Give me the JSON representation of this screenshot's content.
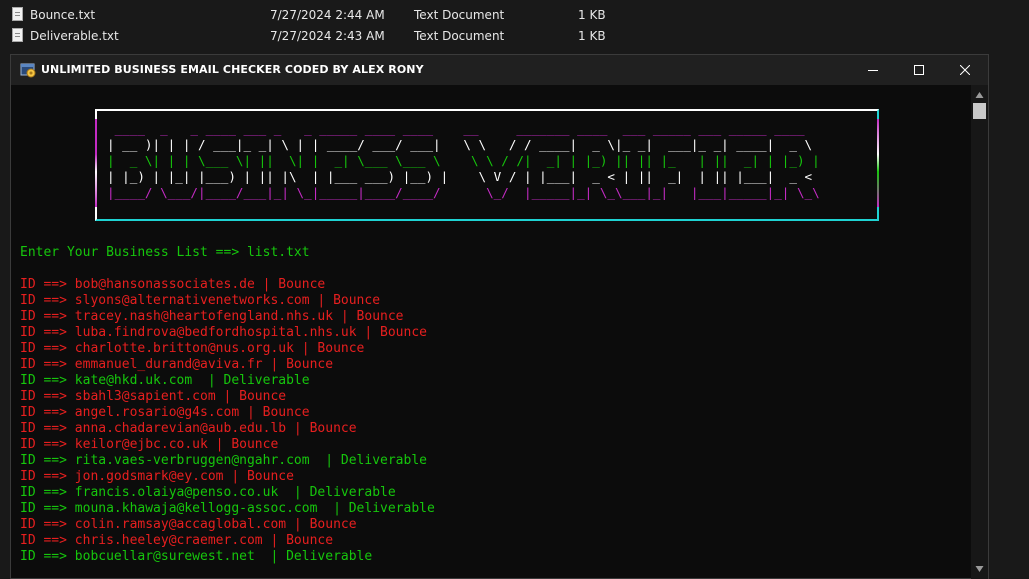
{
  "explorer": {
    "files": [
      {
        "name": "Bounce.txt",
        "modified": "7/27/2024 2:44 AM",
        "type": "Text Document",
        "size": "1 KB"
      },
      {
        "name": "Deliverable.txt",
        "modified": "7/27/2024 2:43 AM",
        "type": "Text Document",
        "size": "1 KB"
      }
    ]
  },
  "window": {
    "title": "UNLIMITED BUSINESS EMAIL CHECKER CODED BY ALEX RONY",
    "icons": {
      "app": "console-app-icon",
      "minimize": "minimize-icon",
      "maximize": "maximize-icon",
      "close": "close-icon"
    }
  },
  "banner": {
    "lines": [
      " ____  _   _ ____ ___ _   _ _____ ____ ____    __     _______ ____  ___ _____ ___ _____ ____  ",
      "| __ )| | | / ___|_ _| \\ | | ____/ ___/ ___|   \\ \\   / / ____|  _ \\|_ _|  ___|_ _| ____|  _ \\ ",
      "|  _ \\| | | \\___ \\| ||  \\| |  _| \\___ \\___ \\    \\ \\ / /|  _| | |_) || || |_   | ||  _| | |_) |",
      "| |_) | |_| |___) | || |\\  | |___ ___) |__) |    \\ V / | |___|  _ < | ||  _|  | || |___|  _ < ",
      "|____/ \\___/|____/___|_| \\_|_____|____/____/      \\_/  |_____|_| \\_\\___|_|   |___|_____|_| \\_\\"
    ],
    "line_colors": [
      "#c42bc4",
      "#ffffff",
      "#16c60c",
      "#ffffff",
      "#c42bc4"
    ]
  },
  "terminal": {
    "prompt": "Enter Your Business List ==> list.txt",
    "colors": {
      "bounce": "#e71f1f",
      "deliverable": "#16c60c",
      "prompt": "#16c60c"
    },
    "results": [
      {
        "text": "ID ==> bob@hansonassociates.de | Bounce",
        "status": "bounce"
      },
      {
        "text": "ID ==> slyons@alternativenetworks.com | Bounce",
        "status": "bounce"
      },
      {
        "text": "ID ==> tracey.nash@heartofengland.nhs.uk | Bounce",
        "status": "bounce"
      },
      {
        "text": "ID ==> luba.findrova@bedfordhospital.nhs.uk | Bounce",
        "status": "bounce"
      },
      {
        "text": "ID ==> charlotte.britton@nus.org.uk | Bounce",
        "status": "bounce"
      },
      {
        "text": "ID ==> emmanuel_durand@aviva.fr | Bounce",
        "status": "bounce"
      },
      {
        "text": "ID ==> kate@hkd.uk.com  | Deliverable",
        "status": "deliverable"
      },
      {
        "text": "ID ==> sbahl3@sapient.com | Bounce",
        "status": "bounce"
      },
      {
        "text": "ID ==> angel.rosario@g4s.com | Bounce",
        "status": "bounce"
      },
      {
        "text": "ID ==> anna.chadarevian@aub.edu.lb | Bounce",
        "status": "bounce"
      },
      {
        "text": "ID ==> keilor@ejbc.co.uk | Bounce",
        "status": "bounce"
      },
      {
        "text": "ID ==> rita.vaes-verbruggen@ngahr.com  | Deliverable",
        "status": "deliverable"
      },
      {
        "text": "ID ==> jon.godsmark@ey.com | Bounce",
        "status": "bounce"
      },
      {
        "text": "ID ==> francis.olaiya@penso.co.uk  | Deliverable",
        "status": "deliverable"
      },
      {
        "text": "ID ==> mouna.khawaja@kellogg-assoc.com  | Deliverable",
        "status": "deliverable"
      },
      {
        "text": "ID ==> colin.ramsay@accaglobal.com | Bounce",
        "status": "bounce"
      },
      {
        "text": "ID ==> chris.heeley@craemer.com | Bounce",
        "status": "bounce"
      },
      {
        "text": "ID ==> bobcuellar@surewest.net  | Deliverable",
        "status": "deliverable"
      }
    ]
  }
}
